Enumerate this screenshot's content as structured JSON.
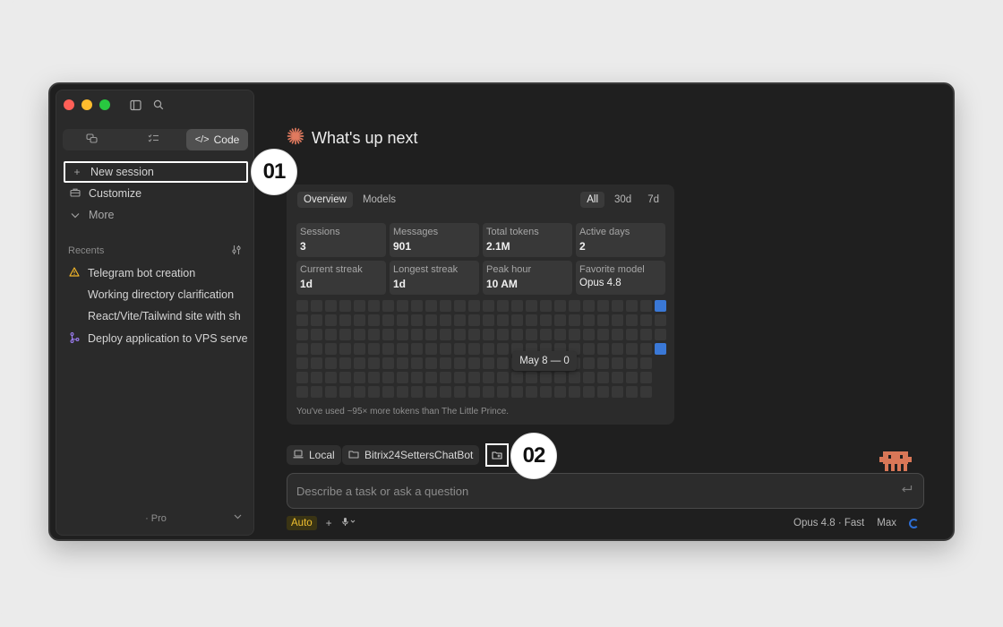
{
  "sidebar": {
    "segments": [
      {
        "label": "",
        "icon": "chat-bubbles-icon"
      },
      {
        "label": "",
        "icon": "checklist-icon"
      },
      {
        "label": "Code",
        "icon": "code-icon"
      }
    ],
    "nav": [
      {
        "label": "New session",
        "icon": "plus-icon"
      },
      {
        "label": "Customize",
        "icon": "briefcase-icon"
      },
      {
        "label": "More",
        "icon": "chevron-down-icon"
      }
    ],
    "recents_label": "Recents",
    "recents": [
      {
        "label": "Telegram bot creation",
        "icon": "warning-icon"
      },
      {
        "label": "Working directory clarification",
        "icon": ""
      },
      {
        "label": "React/Vite/Tailwind site with sh",
        "icon": ""
      },
      {
        "label": "Deploy application to VPS serve",
        "icon": "branch-icon"
      }
    ],
    "plan": "· Pro"
  },
  "main": {
    "headline": "What's up next",
    "tabs": [
      "Overview",
      "Models"
    ],
    "ranges": [
      "All",
      "30d",
      "7d"
    ],
    "stats": [
      {
        "label": "Sessions",
        "value": "3"
      },
      {
        "label": "Messages",
        "value": "901"
      },
      {
        "label": "Total tokens",
        "value": "2.1M"
      },
      {
        "label": "Active days",
        "value": "2"
      },
      {
        "label": "Current streak",
        "value": "1d"
      },
      {
        "label": "Longest streak",
        "value": "1d"
      },
      {
        "label": "Peak hour",
        "value": "10 AM"
      },
      {
        "label": "Favorite model",
        "value": "Opus 4.8"
      }
    ],
    "activity": {
      "columns": 26,
      "rows": 7,
      "active_cells": [
        [
          25,
          0
        ],
        [
          25,
          3
        ]
      ]
    },
    "tooltip": "May 8 — 0",
    "footnote": "You've used ~95× more tokens than The Little Prince.",
    "chips": {
      "local": "Local",
      "folder": "Bitrix24SettersChatBot"
    },
    "prompt_placeholder": "Describe a task or ask a question",
    "bottom": {
      "auto": "Auto",
      "model": "Opus 4.8 · Fast",
      "effort": "Max"
    }
  },
  "callouts": [
    "01",
    "02"
  ],
  "colors": {
    "accent_blue": "#3a78d6",
    "auto_yellow": "#f0c030",
    "spark_orange": "#e07a5f",
    "mascot_orange": "#d97757"
  }
}
